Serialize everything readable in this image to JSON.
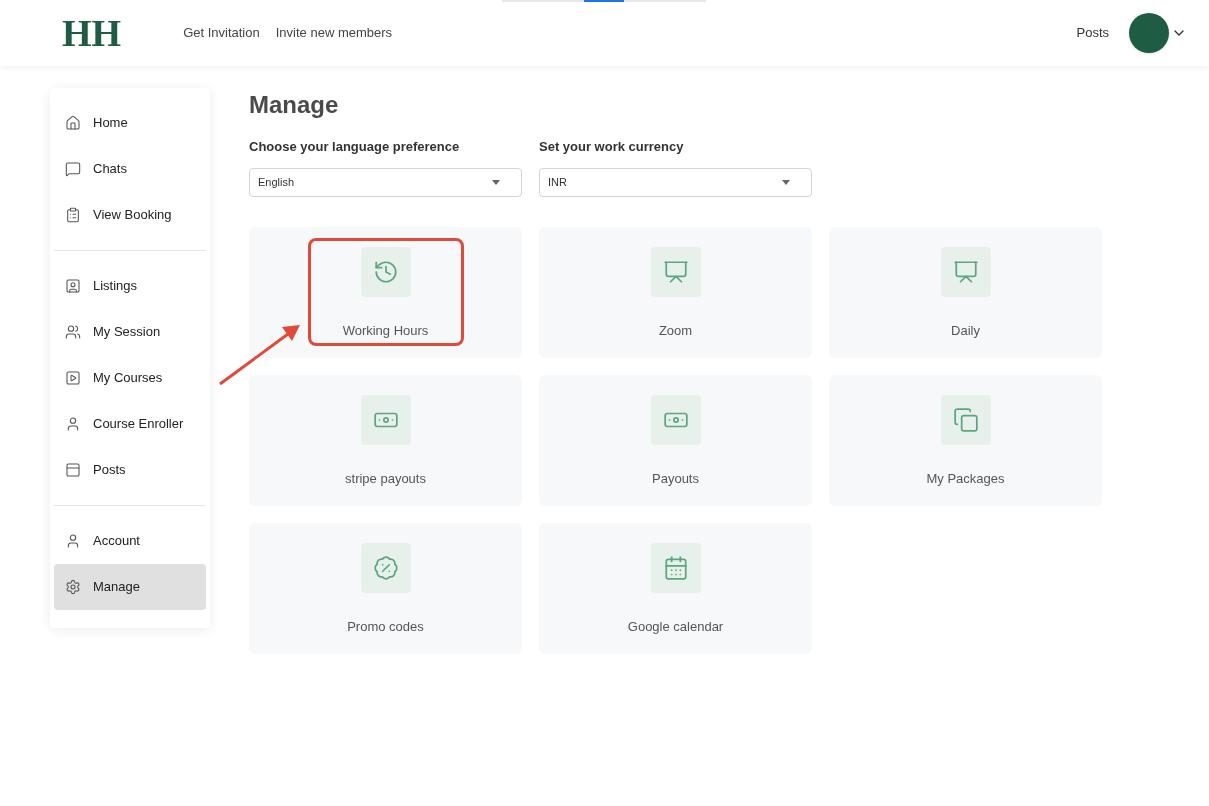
{
  "header": {
    "logo": "HH",
    "nav": [
      "Get Invitation",
      "Invite new members"
    ],
    "right_link": "Posts"
  },
  "sidebar": {
    "groups": [
      [
        {
          "label": "Home",
          "selected": false
        },
        {
          "label": "Chats",
          "selected": false
        },
        {
          "label": "View Booking",
          "selected": false
        }
      ],
      [
        {
          "label": "Listings",
          "selected": false
        },
        {
          "label": "My Session",
          "selected": false
        },
        {
          "label": "My Courses",
          "selected": false
        },
        {
          "label": "Course Enroller",
          "selected": false
        },
        {
          "label": "Posts",
          "selected": false
        }
      ],
      [
        {
          "label": "Account",
          "selected": false
        },
        {
          "label": "Manage",
          "selected": true
        }
      ]
    ]
  },
  "page": {
    "title": "Manage",
    "selects": [
      {
        "label": "Choose your language preference",
        "value": "English"
      },
      {
        "label": "Set your work currency",
        "value": "INR"
      }
    ],
    "cards": [
      {
        "label": "Working Hours",
        "highlighted": true
      },
      {
        "label": "Zoom",
        "highlighted": false
      },
      {
        "label": "Daily",
        "highlighted": false
      },
      {
        "label": "stripe payouts",
        "highlighted": false
      },
      {
        "label": "Payouts",
        "highlighted": false
      },
      {
        "label": "My Packages",
        "highlighted": false
      },
      {
        "label": "Promo codes",
        "highlighted": false
      },
      {
        "label": "Google calendar",
        "highlighted": false
      }
    ]
  }
}
